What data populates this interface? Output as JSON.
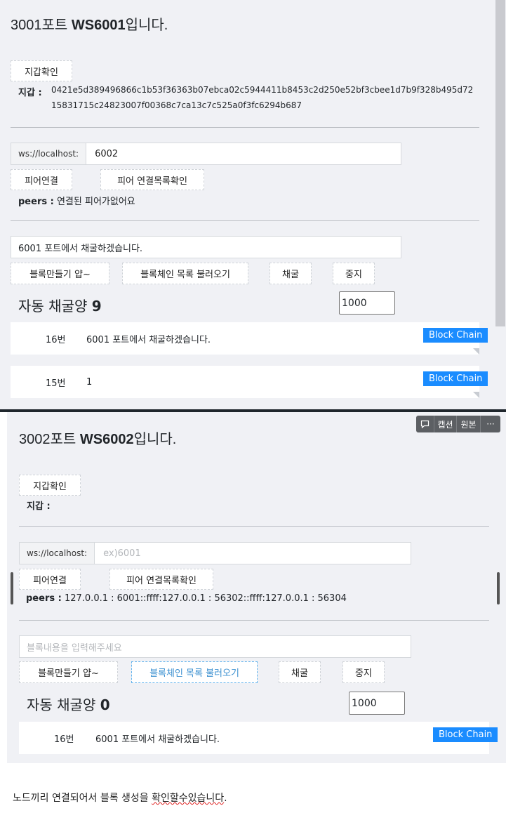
{
  "screen1": {
    "title_prefix": "3001포트 ",
    "title_bold": "WS6001",
    "title_suffix": "입니다.",
    "wallet_button": "지갑확인",
    "wallet_label": "지갑 :",
    "wallet_value": "0421e5d389496866c1b53f36363b07ebca02c5944411b8453c2d250e52bf3cbee1d7b9f328b495d72 15831715c24823007f00368c7ca13c7c525a0f3fc6294b687",
    "ws_prefix": "ws://localhost:",
    "ws_value": "6002",
    "peer_connect_button": "피어연결",
    "peer_list_button": "피어 연결목록확인",
    "peers_label": "peers :",
    "peers_value": "연결된 피어가없어요",
    "block_input_value": "6001 포트에서 채굴하겠습니다.",
    "make_block_button": "블록만들기 얍~",
    "load_chain_button": "블록체인 목록 불러오기",
    "mine_button": "채굴",
    "stop_button": "중지",
    "automine_label": "자동 채굴양",
    "automine_count": "9",
    "automine_input": "1000",
    "blocks": [
      {
        "number": "16번",
        "data": "6001 포트에서 채굴하겠습니다.",
        "badge": "Block Chain"
      },
      {
        "number": "15번",
        "data": "1",
        "badge": "Block Chain"
      }
    ]
  },
  "screen2": {
    "title_prefix": "3002포트 ",
    "title_bold": "WS6002",
    "title_suffix": "입니다.",
    "wallet_button": "지갑확인",
    "wallet_label": "지갑 :",
    "ws_prefix": "ws://localhost:",
    "ws_placeholder": "ex)6001",
    "peer_connect_button": "피어연결",
    "peer_list_button": "피어 연결목록확인",
    "peers_label": "peers :",
    "peers_value": "127.0.0.1 : 6001::ffff:127.0.0.1 : 56302::ffff:127.0.0.1 : 56304",
    "block_input_placeholder": "블록내용을 입력해주세요",
    "make_block_button": "블록만들기 얍~",
    "load_chain_button": "블록체인 목록 불러오기",
    "mine_button": "채굴",
    "stop_button": "중지",
    "automine_label": "자동 채굴양",
    "automine_count": "0",
    "automine_input": "1000",
    "blocks": [
      {
        "number": "16번",
        "data": "6001 포트에서 채굴하겠습니다.",
        "badge": "Block Chain"
      }
    ]
  },
  "overlay_toolbar": {
    "caption_label": "캡션",
    "original_label": "원본",
    "more_label": "···"
  },
  "caption": {
    "part1": "노드끼리 연결되어서 블록 생성을 ",
    "part2": "확인할수있습니다",
    "part3": "."
  }
}
